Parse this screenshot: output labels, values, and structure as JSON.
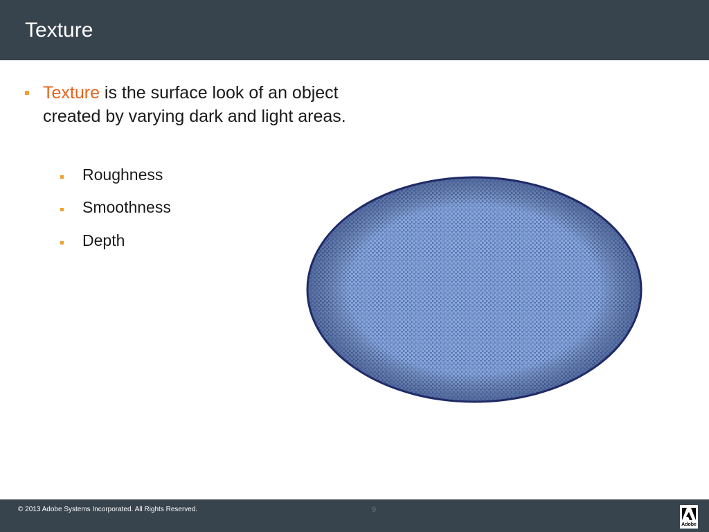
{
  "slide": {
    "title": "Texture",
    "main_bullet": {
      "highlight": "Texture",
      "rest": " is the surface look of an object created by varying dark and light areas."
    },
    "sub_bullets": [
      "Roughness",
      "Smoothness",
      "Depth"
    ]
  },
  "illustration": {
    "icon": "textured-fabric-ellipse",
    "fill_color": "#6f8fc8",
    "outline_color": "#1f2a66"
  },
  "footer": {
    "copyright": "© 2013 Adobe Systems Incorporated.  All Rights Reserved.",
    "page_number": "9",
    "logo_text": "Adobe"
  },
  "colors": {
    "bar": "#37434d",
    "accent": "#e8631b",
    "bullet": "#f0a030"
  }
}
